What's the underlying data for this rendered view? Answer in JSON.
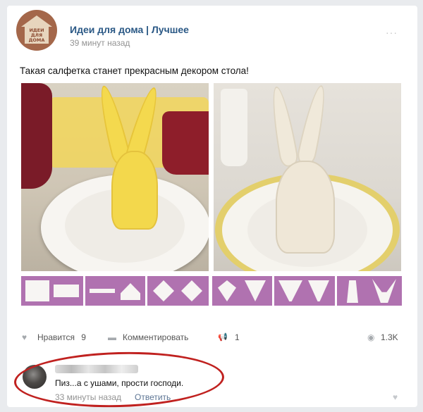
{
  "post": {
    "group_name": "Идеи для дома | Лучшее",
    "time": "39 минут назад",
    "more_icon": "···",
    "avatar_text": "ИДЕИ ДЛЯ ДОМА",
    "text": "Такая салфетка станет прекрасным декором стола!"
  },
  "actions": {
    "like_icon": "♥",
    "like_label": "Нравится",
    "like_count": "9",
    "comment_icon": "▬",
    "comment_label": "Комментировать",
    "share_icon": "📢",
    "share_count": "1",
    "views_icon": "◉",
    "views_count": "1.3K"
  },
  "comment": {
    "text": "Пиз...а с ушами, прости господи.",
    "time": "33 минуты назад",
    "reply_label": "Ответить",
    "like_icon": "♥"
  },
  "colors": {
    "link": "#2a5885",
    "oval": "#c0211f",
    "steps_bg": "#b072b0"
  }
}
